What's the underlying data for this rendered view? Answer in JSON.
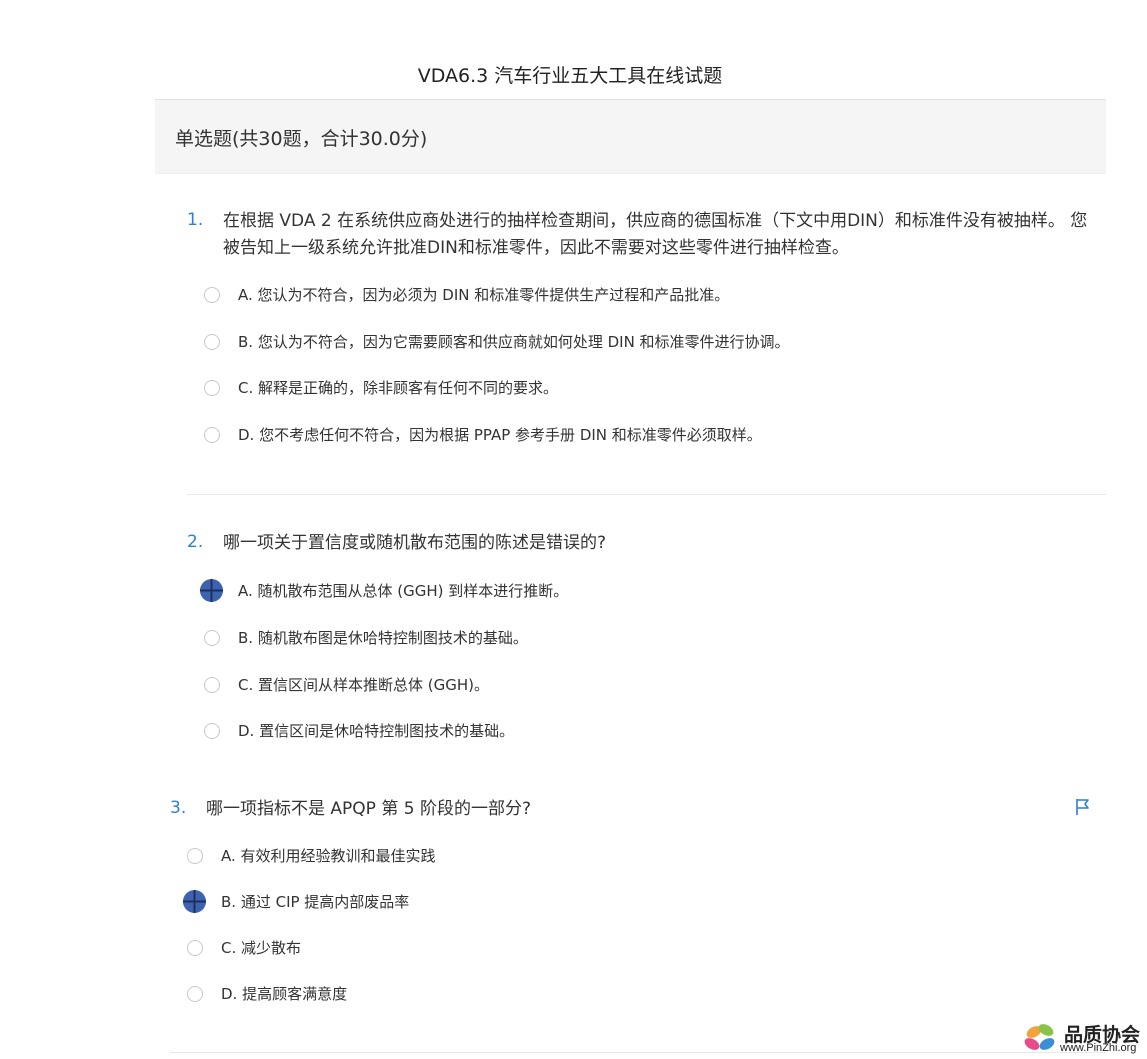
{
  "page": {
    "title": "VDA6.3 汽车行业五大工具在线试题"
  },
  "section": {
    "title": "单选题(共30题，合计30.0分)"
  },
  "questions": [
    {
      "number": "1.",
      "text": "在根据 VDA 2 在系统供应商处进行的抽样检查期间，供应商的德国标准（下文中用DIN）和标准件没有被抽样。 您被告知上一级系统允许批准DIN和标准零件，因此不需要对这些零件进行抽样检查。",
      "options": [
        {
          "label": "A. 您认为不符合，因为必须为 DIN 和标准零件提供生产过程和产品批准。",
          "selected": false
        },
        {
          "label": "B. 您认为不符合，因为它需要顾客和供应商就如何处理 DIN 和标准零件进行协调。",
          "selected": false
        },
        {
          "label": "C. 解释是正确的，除非顾客有任何不同的要求。",
          "selected": false
        },
        {
          "label": "D. 您不考虑任何不符合，因为根据 PPAP 参考手册 DIN 和标准零件必须取样。",
          "selected": false
        }
      ]
    },
    {
      "number": "2.",
      "text": "哪一项关于置信度或随机散布范围的陈述是错误的?",
      "options": [
        {
          "label": "A. 随机散布范围从总体 (GGH) 到样本进行推断。",
          "selected": true
        },
        {
          "label": "B. 随机散布图是休哈特控制图技术的基础。",
          "selected": false
        },
        {
          "label": "C. 置信区间从样本推断总体 (GGH)。",
          "selected": false
        },
        {
          "label": "D. 置信区间是休哈特控制图技术的基础。",
          "selected": false
        }
      ]
    },
    {
      "number": "3.",
      "text": "哪一项指标不是 APQP 第 5 阶段的一部分?",
      "options": [
        {
          "label": "A. 有效利用经验教训和最佳实践",
          "selected": false
        },
        {
          "label": "B. 通过 CIP 提高内部废品率",
          "selected": true
        },
        {
          "label": "C. 减少散布",
          "selected": false
        },
        {
          "label": "D. 提高顾客满意度",
          "selected": false
        }
      ]
    }
  ],
  "icons": {
    "flag": "flag-icon",
    "selected_radio": "crosshair-circle-icon"
  },
  "colors": {
    "accent": "#2f7fd0",
    "selected_radio": "#3d63b0",
    "section_bg": "#f5f5f5"
  },
  "watermark": {
    "name_cn": "品质协会",
    "url": "www.PinZhi.org"
  }
}
